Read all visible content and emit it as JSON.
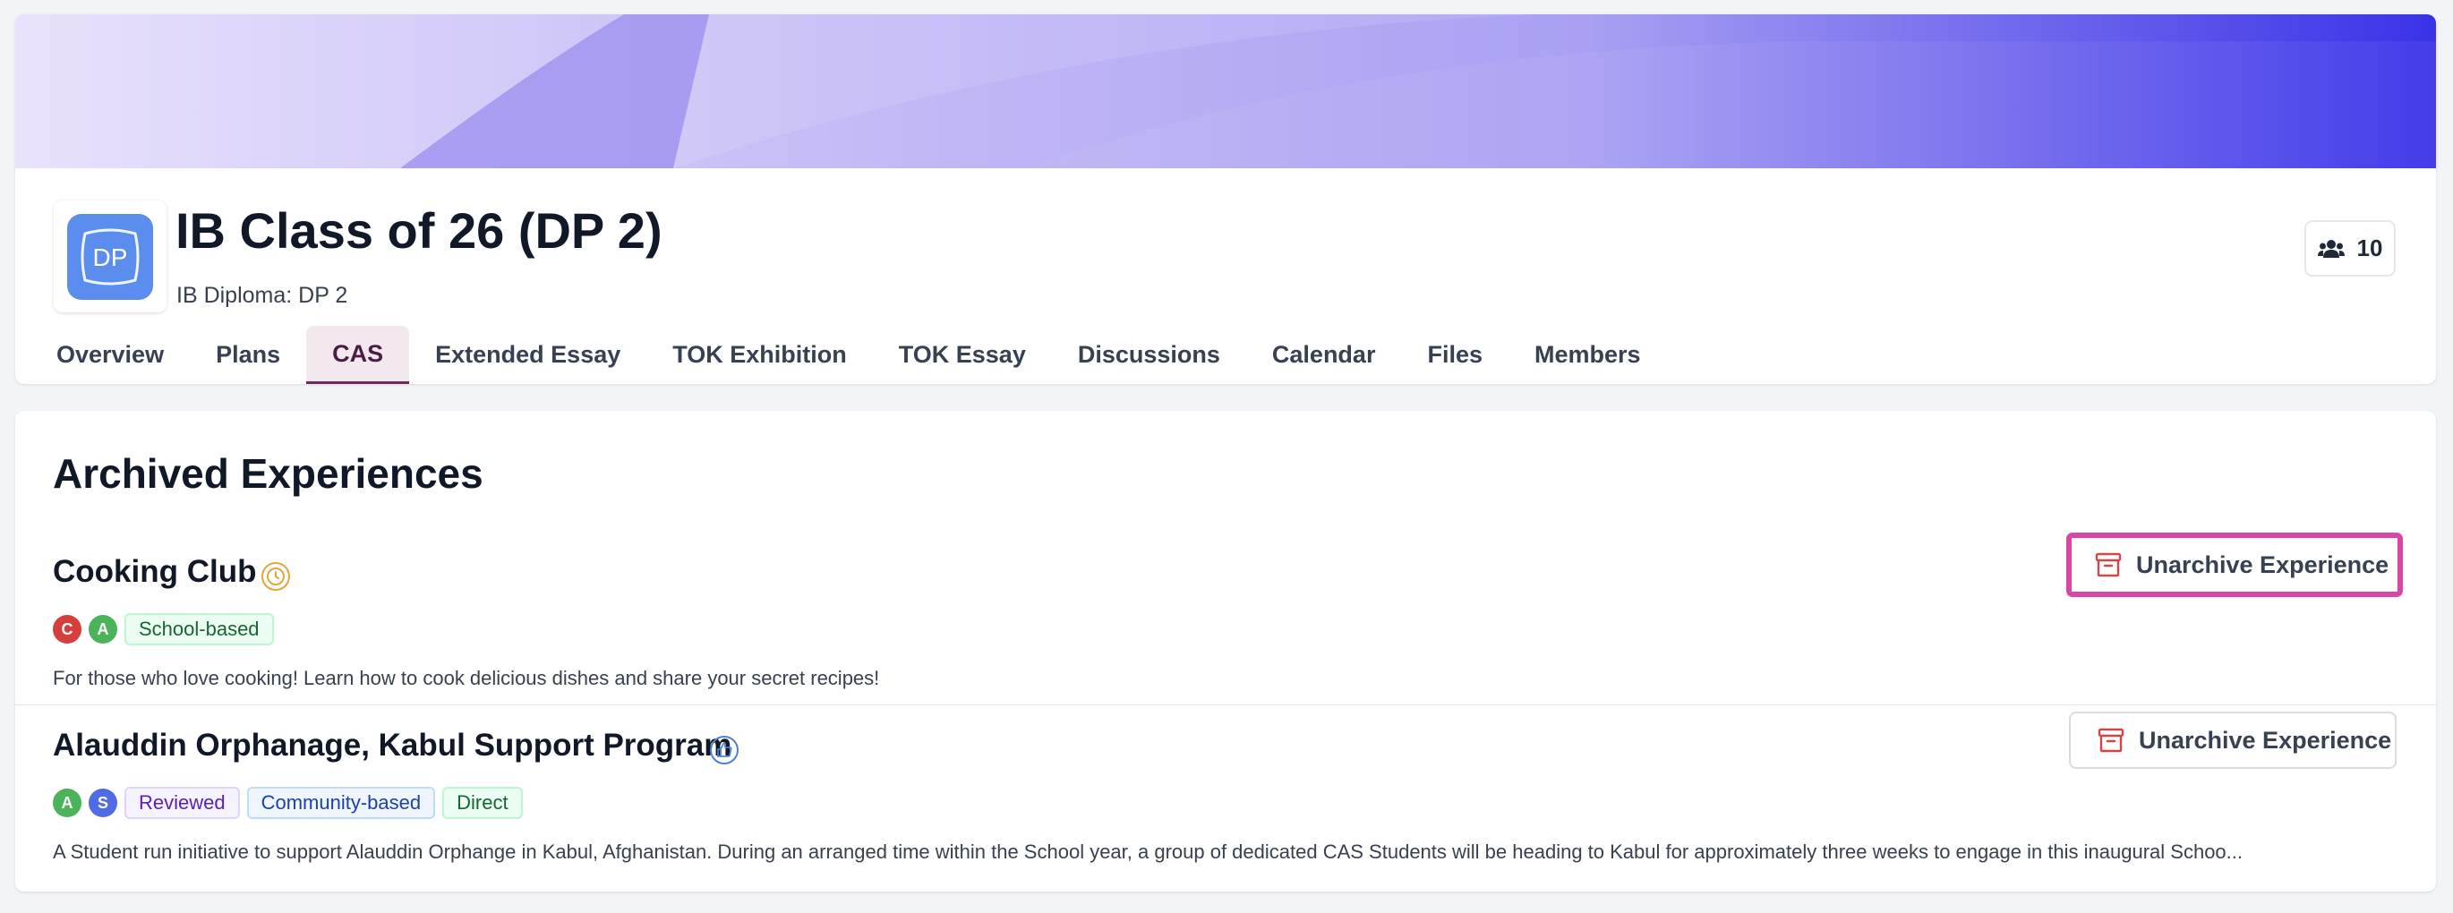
{
  "class": {
    "logo_text": "DP",
    "title": "IB Class of 26 (DP 2)",
    "subtitle": "IB Diploma: DP 2",
    "member_count": "10"
  },
  "tabs": [
    {
      "label": "Overview",
      "active": false
    },
    {
      "label": "Plans",
      "active": false
    },
    {
      "label": "CAS",
      "active": true
    },
    {
      "label": "Extended Essay",
      "active": false
    },
    {
      "label": "TOK Exhibition",
      "active": false
    },
    {
      "label": "TOK Essay",
      "active": false
    },
    {
      "label": "Discussions",
      "active": false
    },
    {
      "label": "Calendar",
      "active": false
    },
    {
      "label": "Files",
      "active": false
    },
    {
      "label": "Members",
      "active": false
    }
  ],
  "section": {
    "title": "Archived Experiences"
  },
  "experiences": [
    {
      "title": "Cooking Club",
      "status_icon": "clock-icon",
      "avatars": [
        {
          "letter": "C",
          "color": "#d63e3e"
        },
        {
          "letter": "A",
          "color": "#4bb35a"
        }
      ],
      "tags": [
        "School-based"
      ],
      "description": "For those who love cooking! Learn how to cook delicious dishes and share your secret recipes!",
      "button_label": "Unarchive Experience"
    },
    {
      "title": "Alauddin Orphanage, Kabul Support Program",
      "status_icon": "thumbs-up-icon",
      "avatars": [
        {
          "letter": "A",
          "color": "#4bb35a"
        },
        {
          "letter": "S",
          "color": "#4f6be6"
        }
      ],
      "tags": [
        "Reviewed",
        "Community-based",
        "Direct"
      ],
      "description": "A Student run initiative to support Alauddin Orphange in Kabul, Afghanistan. During an arranged time within the School year, a group of dedicated CAS Students will be heading to Kabul for approximately three weeks to engage in this inaugural Schoo...",
      "button_label": "Unarchive Experience"
    }
  ],
  "colors": {
    "accent": "#6b2d5c",
    "highlight_border": "#d946a6",
    "banner_start": "#e6e0fb",
    "banner_end": "#3a32e8",
    "archive_icon": "#d64545"
  }
}
